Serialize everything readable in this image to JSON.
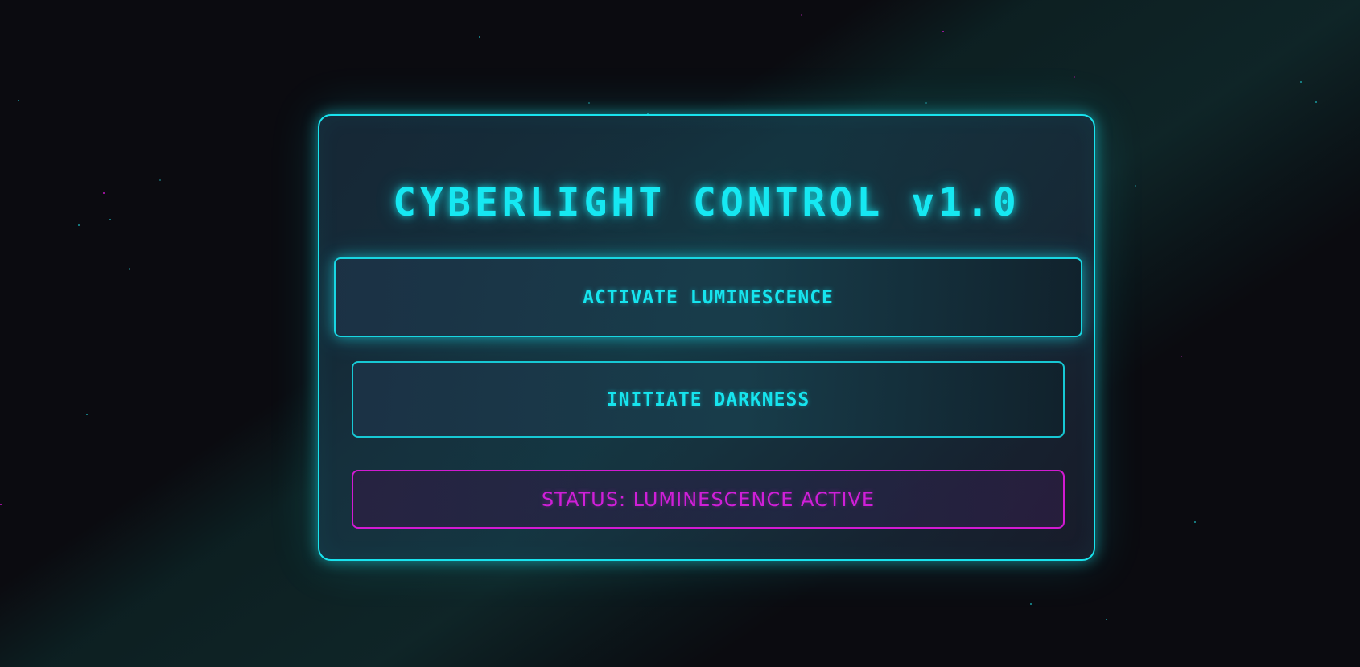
{
  "panel": {
    "title": "CYBERLIGHT CONTROL v1.0",
    "activate_button": "ACTIVATE LUMINESCENCE",
    "darkness_button": "INITIATE DARKNESS",
    "status": "STATUS: LUMINESCENCE ACTIVE"
  },
  "colors": {
    "accent_cyan": "#19e3ee",
    "accent_magenta": "#d21ad2",
    "background": "#0b0b10"
  }
}
